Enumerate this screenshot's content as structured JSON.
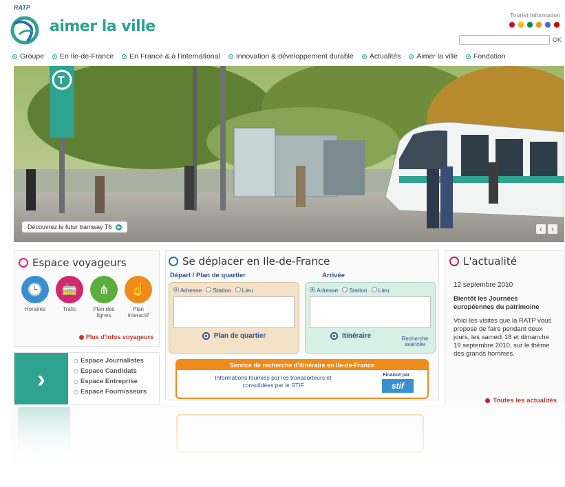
{
  "header": {
    "brand_small": "RATP",
    "logo_text": "aimer la ville",
    "tourist_label": "Tourist information",
    "flags": [
      "#c8102e",
      "#f2c200",
      "#008c45",
      "#e5a000",
      "#3a6fd8",
      "#d00000"
    ],
    "search_placeholder": "",
    "search_button": "OK"
  },
  "nav": {
    "items": [
      "Groupe",
      "En Ile-de-France",
      "En France & à l'international",
      "Innovation & développement durable",
      "Actualités",
      "Aimer la ville",
      "Fondation"
    ]
  },
  "hero": {
    "caption": "Découvrez le futur tramway T6"
  },
  "voyageurs": {
    "title": "Espace voyageurs",
    "icons": [
      {
        "label": "Horaires",
        "color": "#3a8fd0",
        "icon": "clock-icon"
      },
      {
        "label": "Trafic",
        "color": "#d3276e",
        "icon": "tram-icon"
      },
      {
        "label": "Plan des lignes",
        "color": "#5bae3e",
        "icon": "map-lines-icon"
      },
      {
        "label": "Plan interactif",
        "color": "#f08a1a",
        "icon": "hand-pointer-icon"
      }
    ],
    "more_link": "Plus d'infos voyageurs"
  },
  "espaces": {
    "links": [
      "Espace Journalistes",
      "Espace Candidats",
      "Espace Entreprise",
      "Espace Fournisseurs"
    ]
  },
  "deplacer": {
    "title": "Se déplacer en Ile-de-France",
    "depart_label": "Départ / Plan de quartier",
    "arrivee_label": "Arrivée",
    "radio_options": [
      "Adresse",
      "Station",
      "Lieu"
    ],
    "depart_button": "Plan de quartier",
    "arrivee_button": "Itinéraire",
    "advanced_link": "Recherche avancée",
    "stif_header": "Service de recherche d'itinéraire en Ile-de-France",
    "stif_text": "Informations fournies par les transporteurs et consolidées par le STIF",
    "stif_financed": "Financé par :",
    "stif_logo": "stif"
  },
  "actualite": {
    "title": "L'actualité",
    "date": "12 septembre 2010",
    "headline": "Bientôt les Journées européennes du patrimoine",
    "body": "Voici les visites que la RATP vous propose de faire pendant deux jours, les samedi 18 et dimanche 19 septembre 2010, sur le thème des grands hommes.",
    "all_link": "Toutes les actualités"
  },
  "colors": {
    "accent_green": "#2ea38f",
    "voyageurs_ring": "#d3276e",
    "deplacer_ring": "#2a6db3",
    "actualite_ring": "#c2185b",
    "link_red": "#c0392b",
    "stif_orange": "#f08a1a"
  }
}
